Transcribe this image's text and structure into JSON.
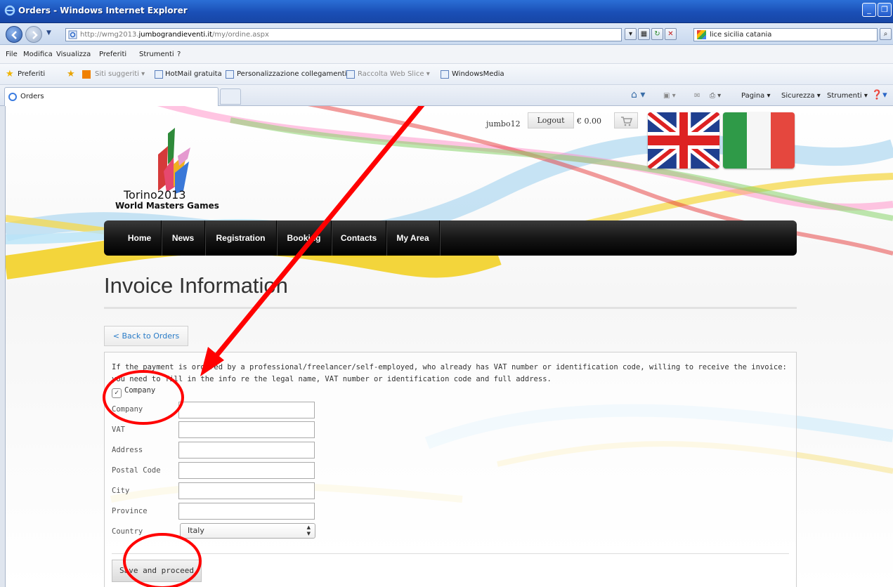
{
  "window": {
    "title": "Orders - Windows Internet Explorer"
  },
  "address": {
    "url_prefix": "http://wmg2013.",
    "url_domain": "jumbograndieventi.it",
    "url_path": "/my/ordine.aspx",
    "search_value": "lice sicilia catania"
  },
  "menubar": [
    "File",
    "Modifica",
    "Visualizza",
    "Preferiti",
    "Strumenti",
    "?"
  ],
  "favorites": {
    "label": "Preferiti",
    "items": [
      "Siti suggeriti ▾",
      "HotMail gratuita",
      "Personalizzazione collegamenti",
      "Raccolta Web Slice ▾",
      "WindowsMedia"
    ]
  },
  "tab": {
    "label": "Orders"
  },
  "toolbar": {
    "page": "Pagina ▾",
    "security": "Sicurezza ▾",
    "tools": "Strumenti ▾"
  },
  "site": {
    "logo_line1": "Torino2013",
    "logo_line2": "World Masters Games",
    "username": "jumbo12",
    "logout": "Logout",
    "cart_amount": "€ 0.00",
    "nav": [
      "Home",
      "News",
      "Registration",
      "Booking",
      "Contacts",
      "My Area"
    ]
  },
  "page": {
    "title": "Invoice Information",
    "back": "< Back to Orders",
    "info": "If the payment is ordered by a professional/freelancer/self-employed, who already has VAT number or identification code, willing to receive the invoice: you need to fill in the info re the legal name, VAT number or identification code and full address.",
    "checkbox_label": "Company",
    "checkbox_checked": true,
    "fields": {
      "company": "Company",
      "vat": "VAT",
      "address": "Address",
      "postal": "Postal Code",
      "city": "City",
      "province": "Province",
      "country": "Country"
    },
    "country_value": "Italy",
    "save": "Save and proceed"
  }
}
